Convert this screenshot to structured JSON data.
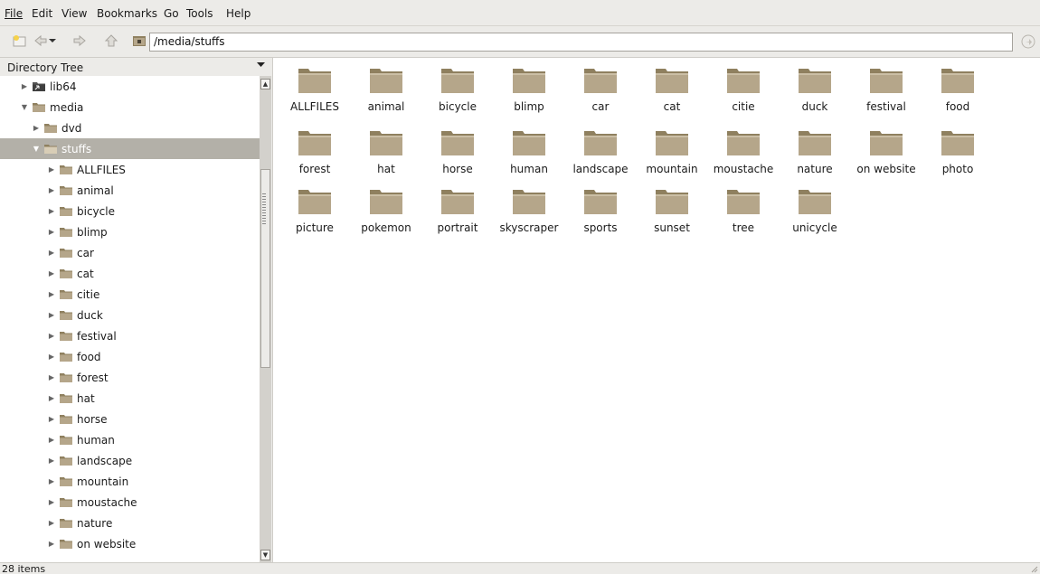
{
  "menubar": {
    "items": [
      {
        "label": "File"
      },
      {
        "label": "Edit"
      },
      {
        "label": "View"
      },
      {
        "label": "Bookmarks"
      },
      {
        "label": "Go"
      },
      {
        "label": "Tools"
      },
      {
        "label": "Help"
      }
    ]
  },
  "toolbar": {
    "address": "/media/stuffs",
    "icons": [
      "new-tab-icon",
      "back-icon",
      "history-dropdown-icon",
      "forward-icon",
      "up-icon",
      "home-folder-icon",
      "go-icon"
    ]
  },
  "tree": {
    "title": "Directory Tree",
    "rows": [
      {
        "label": "lib64",
        "expander": "▶"
      },
      {
        "label": "media",
        "expander": "▼"
      },
      {
        "label": "dvd",
        "expander": "▶"
      },
      {
        "label": "stuffs",
        "expander": "▼"
      },
      {
        "label": "ALLFILES",
        "expander": "▶"
      },
      {
        "label": "animal",
        "expander": "▶"
      },
      {
        "label": "bicycle",
        "expander": "▶"
      },
      {
        "label": "blimp",
        "expander": "▶"
      },
      {
        "label": "car",
        "expander": "▶"
      },
      {
        "label": "cat",
        "expander": "▶"
      },
      {
        "label": "citie",
        "expander": "▶"
      },
      {
        "label": "duck",
        "expander": "▶"
      },
      {
        "label": "festival",
        "expander": "▶"
      },
      {
        "label": "food",
        "expander": "▶"
      },
      {
        "label": "forest",
        "expander": "▶"
      },
      {
        "label": "hat",
        "expander": "▶"
      },
      {
        "label": "horse",
        "expander": "▶"
      },
      {
        "label": "human",
        "expander": "▶"
      },
      {
        "label": "landscape",
        "expander": "▶"
      },
      {
        "label": "mountain",
        "expander": "▶"
      },
      {
        "label": "moustache",
        "expander": "▶"
      },
      {
        "label": "nature",
        "expander": "▶"
      },
      {
        "label": "on website",
        "expander": "▶"
      }
    ],
    "selected": "stuffs"
  },
  "files": [
    "ALLFILES",
    "animal",
    "bicycle",
    "blimp",
    "car",
    "cat",
    "citie",
    "duck",
    "festival",
    "food",
    "forest",
    "hat",
    "horse",
    "human",
    "landscape",
    "mountain",
    "moustache",
    "nature",
    "on website",
    "photo",
    "picture",
    "pokemon",
    "portrait",
    "skyscraper",
    "sports",
    "sunset",
    "tree",
    "unicycle"
  ],
  "status": {
    "text": "28 items"
  },
  "colors": {
    "folder": "#b5a68a",
    "folder_dark": "#8f805f",
    "selected_row": "#b3b0a8",
    "chrome": "#ecebe8"
  }
}
